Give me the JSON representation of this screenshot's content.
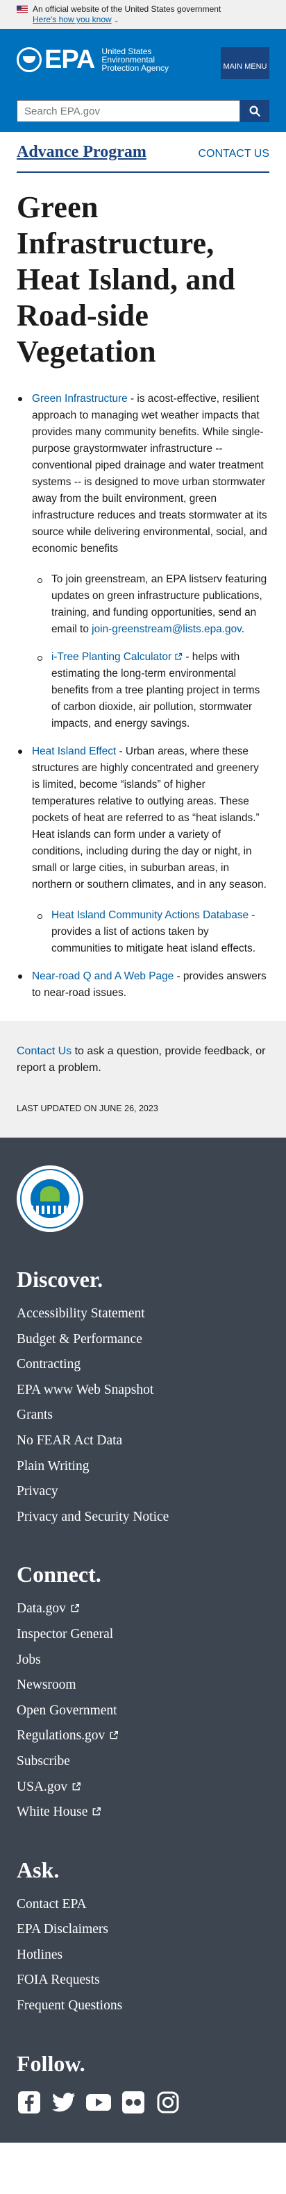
{
  "gov_banner": {
    "text": "An official website of the United States government",
    "how_link": "Here's how you know"
  },
  "header": {
    "logo_letters": "EPA",
    "agency_name": "United States Environmental Protection Agency",
    "menu_label": "MAIN MENU",
    "search_placeholder": "Search EPA.gov"
  },
  "program": {
    "title": "Advance Program",
    "contact": "CONTACT US"
  },
  "page_title": "Green Infrastructure, Heat Island, and Road-side Vegetation",
  "items": [
    {
      "link": "Green Infrastructure",
      "text": " - is acost-effective, resilient approach to managing wet weather impacts that provides many community benefits. While single-purpose graystormwater infrastructure -- conventional piped drainage and water treatment systems -- is designed to move urban stormwater away from the built environment, green infrastructure reduces and treats stormwater at its source while delivering environmental, social, and economic benefits",
      "sub": [
        {
          "prefix": "To join greenstream, an EPA listserv featuring updates on green infrastructure publications, training, and funding opportunities, send an email to ",
          "link": "join-greenstream@lists.epa.gov",
          "suffix": "."
        },
        {
          "link": "i-Tree Planting Calculator",
          "text": " - helps with estimating the long-term environmental benefits from a tree planting project in terms of carbon dioxide, air pollution, stormwater impacts, and energy savings."
        }
      ]
    },
    {
      "link": "Heat Island Effect",
      "text": " - Urban areas, where these structures are highly concentrated and greenery is limited, become “islands” of higher temperatures relative to outlying areas. These pockets of heat are referred to as “heat islands.” Heat islands can form under a variety of conditions, including during the day or night, in small or large cities, in suburban areas, in northern or southern climates, and in any season.",
      "sub": [
        {
          "link": "Heat Island Community Actions Database",
          "text": " - provides a list of actions taken by communities to mitigate heat island effects."
        }
      ]
    },
    {
      "link": "Near-road Q and A Web Page",
      "text": " - provides answers to near-road issues."
    }
  ],
  "feedback": {
    "link": "Contact Us",
    "text": " to ask a question, provide feedback, or report a problem.",
    "updated": "LAST UPDATED ON JUNE 26, 2023"
  },
  "footer": {
    "discover": {
      "heading": "Discover.",
      "links": [
        "Accessibility Statement",
        "Budget & Performance",
        "Contracting",
        "EPA www Web Snapshot",
        "Grants",
        "No FEAR Act Data",
        "Plain Writing",
        "Privacy",
        "Privacy and Security Notice"
      ]
    },
    "connect": {
      "heading": "Connect.",
      "links": [
        "Data.gov",
        "Inspector General",
        "Jobs",
        "Newsroom",
        "Open Government",
        "Regulations.gov",
        "Subscribe",
        "USA.gov",
        "White House"
      ]
    },
    "ask": {
      "heading": "Ask.",
      "links": [
        "Contact EPA",
        "EPA Disclaimers",
        "Hotlines",
        "FOIA Requests",
        "Frequent Questions"
      ]
    },
    "follow": {
      "heading": "Follow.",
      "icons": [
        "facebook-icon",
        "twitter-icon",
        "youtube-icon",
        "flickr-icon",
        "instagram-icon"
      ]
    }
  },
  "colors": {
    "header_blue": "#0071bc",
    "dark_blue": "#1a4480",
    "link_blue": "#005ea2",
    "footer_bg": "#3d4551"
  }
}
